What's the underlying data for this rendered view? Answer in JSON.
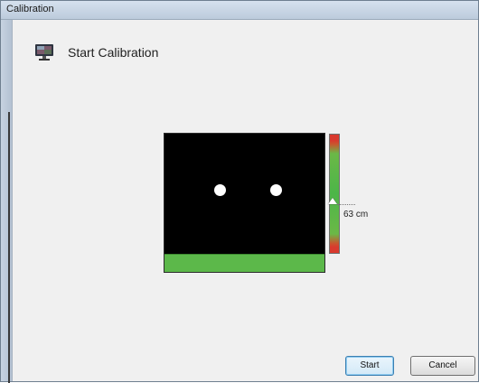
{
  "window": {
    "title": "Calibration"
  },
  "header": {
    "icon": "monitor-icon",
    "title": "Start Calibration"
  },
  "preview": {
    "eyes_detected": 2,
    "tracking_status_color": "#5cb84a"
  },
  "distance_indicator": {
    "value_label": "63 cm",
    "colors": {
      "good": "#4cb648",
      "bad": "#d93a2e"
    }
  },
  "buttons": {
    "start_label": "Start",
    "cancel_label": "Cancel"
  }
}
